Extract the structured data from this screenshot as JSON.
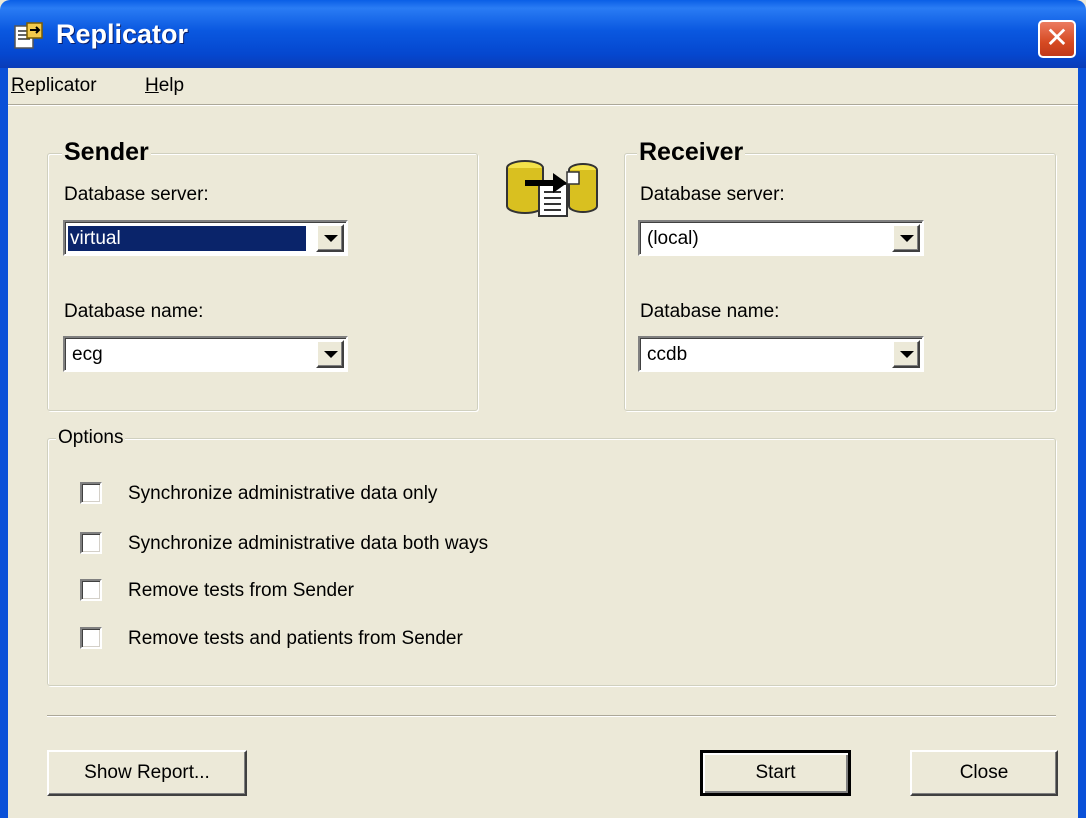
{
  "window": {
    "title": "Replicator",
    "close_glyph": "✕",
    "app_icon": "replicator-app-icon"
  },
  "menu": {
    "items": [
      {
        "label": "Replicator"
      },
      {
        "label": "Help"
      }
    ]
  },
  "sender": {
    "title": "Sender",
    "server_label": "Database server:",
    "server_value": "virtual",
    "name_label": "Database name:",
    "name_value": "ecg"
  },
  "receiver": {
    "title": "Receiver",
    "server_label": "Database server:",
    "server_value": "(local)",
    "name_label": "Database name:",
    "name_value": "ccdb"
  },
  "transfer_icon": "database-transfer-icon",
  "options": {
    "title": "Options",
    "items": [
      {
        "label": "Synchronize administrative data only",
        "checked": false
      },
      {
        "label": "Synchronize administrative data both ways",
        "checked": false
      },
      {
        "label": "Remove tests from Sender",
        "checked": false
      },
      {
        "label": "Remove tests and patients from Sender",
        "checked": false
      }
    ]
  },
  "buttons": {
    "show_report": "Show Report...",
    "start": "Start",
    "close": "Close"
  },
  "colors": {
    "titlebar": "#0a58e0",
    "dialog_bg": "#ece9d8",
    "close_button": "#d64a22",
    "selection": "#0a246a"
  }
}
